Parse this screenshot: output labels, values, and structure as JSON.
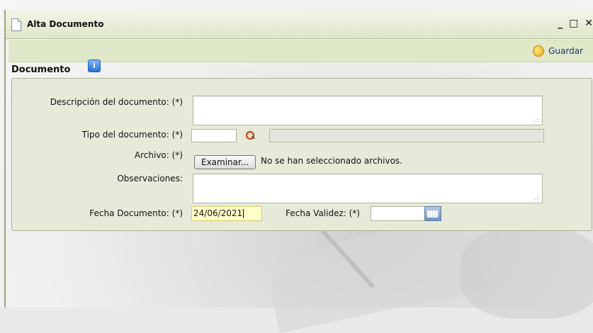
{
  "window": {
    "title": "Alta Documento",
    "controls": {
      "minimize": "_",
      "maximize": "□",
      "close": "✕"
    }
  },
  "toolbar": {
    "save_label": "Guardar",
    "save_icon": "save-circle-icon"
  },
  "section": {
    "title": "Documento",
    "info_icon": "info-icon"
  },
  "form": {
    "descripcion_label": "Descripción del documento: (*)",
    "descripcion_value": "",
    "tipo_label": "Tipo del documento: (*)",
    "tipo_value": "",
    "tipo_desc_value": "",
    "archivo_label": "Archivo: (*)",
    "archivo_button": "Examinar...",
    "archivo_status": "No se han seleccionado archivos.",
    "observaciones_label": "Observaciones:",
    "observaciones_value": "",
    "fecha_documento_label": "Fecha Documento: (*)",
    "fecha_documento_value": "24/06/2021",
    "fecha_validez_label": "Fecha Validez: (*)",
    "fecha_validez_value": ""
  },
  "colors": {
    "titlebar": "#dde6c8",
    "panel": "#e6ebd9",
    "date_highlight": "#ffffc8",
    "save_text": "#1a3a6a"
  }
}
